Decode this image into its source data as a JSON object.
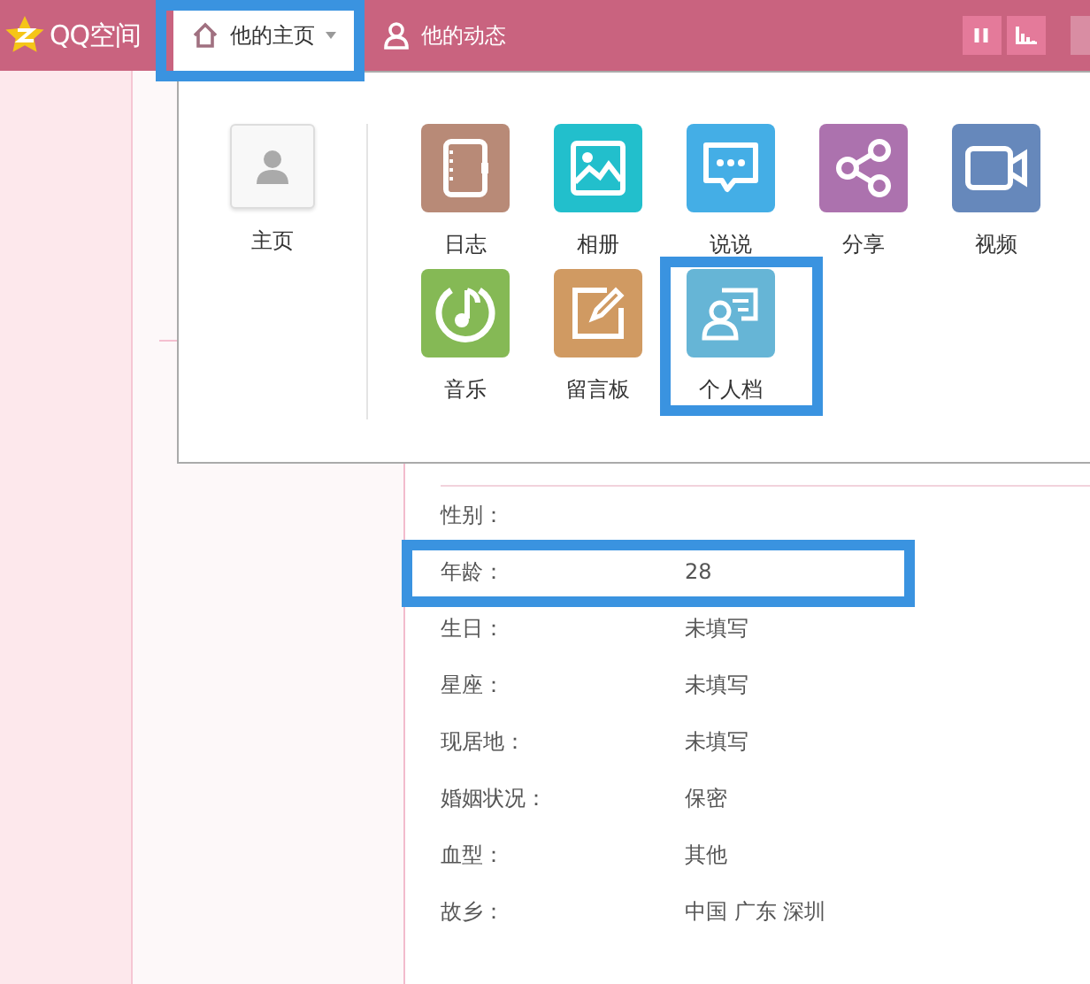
{
  "logo": {
    "text": "QQ空间"
  },
  "nav": [
    {
      "label": "他的主页",
      "kind": "home",
      "selected": true,
      "highlighted": true
    },
    {
      "label": "他的动态",
      "kind": "person",
      "selected": false,
      "highlighted": false
    }
  ],
  "dropdown": {
    "home": {
      "label": "主页"
    },
    "items": [
      {
        "label": "日志",
        "kind": "diary",
        "color": "#b88a77",
        "highlighted": false
      },
      {
        "label": "相册",
        "kind": "photo",
        "color": "#22bfcc",
        "highlighted": false
      },
      {
        "label": "说说",
        "kind": "chat",
        "color": "#44aee6",
        "highlighted": false
      },
      {
        "label": "分享",
        "kind": "share",
        "color": "#ac72ae",
        "highlighted": false
      },
      {
        "label": "视频",
        "kind": "video",
        "color": "#6688bb",
        "highlighted": false
      },
      {
        "label": "音乐",
        "kind": "music",
        "color": "#85b955",
        "highlighted": false
      },
      {
        "label": "留言板",
        "kind": "note",
        "color": "#d09a62",
        "highlighted": false
      },
      {
        "label": "个人档",
        "kind": "profile",
        "color": "#66b5d6",
        "highlighted": true
      }
    ]
  },
  "profile": {
    "rows": [
      {
        "label": "性别：",
        "value": "",
        "highlighted": false
      },
      {
        "label": "年龄：",
        "value": "28",
        "highlighted": true
      },
      {
        "label": "生日：",
        "value": "未填写",
        "highlighted": false
      },
      {
        "label": "星座：",
        "value": "未填写",
        "highlighted": false
      },
      {
        "label": "现居地：",
        "value": "未填写",
        "highlighted": false
      },
      {
        "label": "婚姻状况：",
        "value": "保密",
        "highlighted": false
      },
      {
        "label": "血型：",
        "value": "其他",
        "highlighted": false
      },
      {
        "label": "故乡：",
        "value": "中国 广东 深圳",
        "highlighted": false
      }
    ]
  }
}
